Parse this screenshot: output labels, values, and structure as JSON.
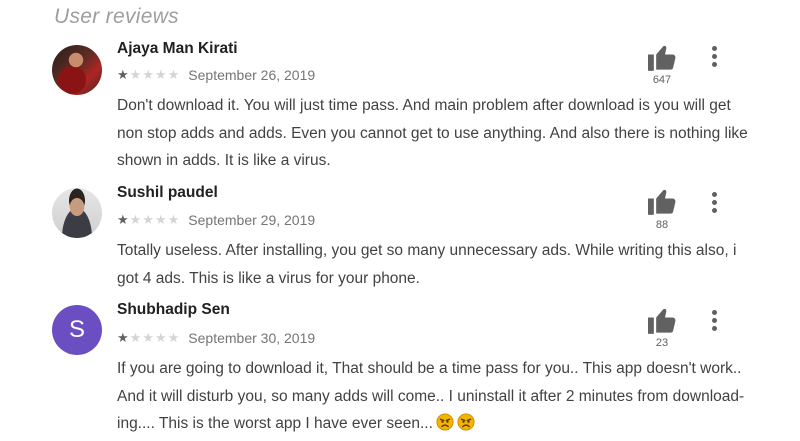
{
  "section": {
    "title": "User reviews"
  },
  "reviews": [
    {
      "author": "Ajaya Man Kirati",
      "avatar": "profile-photo",
      "rating": 1,
      "max_rating": 5,
      "date": "September 26, 2019",
      "helpful_count": "647",
      "text": "Don't download it. You will just time pass. And main problem after download is you will get non stop adds and adds. Even you cannot get to use anything. And also there is nothing like shown in adds. It is like a virus."
    },
    {
      "author": "Sushil paudel",
      "avatar": "profile-photo",
      "rating": 1,
      "max_rating": 5,
      "date": "September 29, 2019",
      "helpful_count": "88",
      "text": "Totally useless. After installing, you get so many unnecessary ads. While writing this also, i got 4 ads. This is like a virus for your phone."
    },
    {
      "author": "Shubhadip Sen",
      "avatar_letter": "S",
      "avatar_color": "#6b4fc2",
      "rating": 1,
      "max_rating": 5,
      "date": "September 30, 2019",
      "helpful_count": "23",
      "text": "If you are going to download it, That should be a time pass for you.. This app doesn't work.. And it will disturb you, so many adds will come.. I uninstall it after 2 minutes from download-ing.... This is the worst app I have ever seen...",
      "emojis": [
        "angry-face-emoji",
        "angry-face-emoji"
      ]
    }
  ],
  "icons": {
    "helpful": "thumbs-up-icon",
    "menu": "more-vert-icon"
  },
  "colors": {
    "star_filled": "#616161",
    "star_empty": "#d4d4d4",
    "letter_avatar": "#6b4fc2"
  }
}
